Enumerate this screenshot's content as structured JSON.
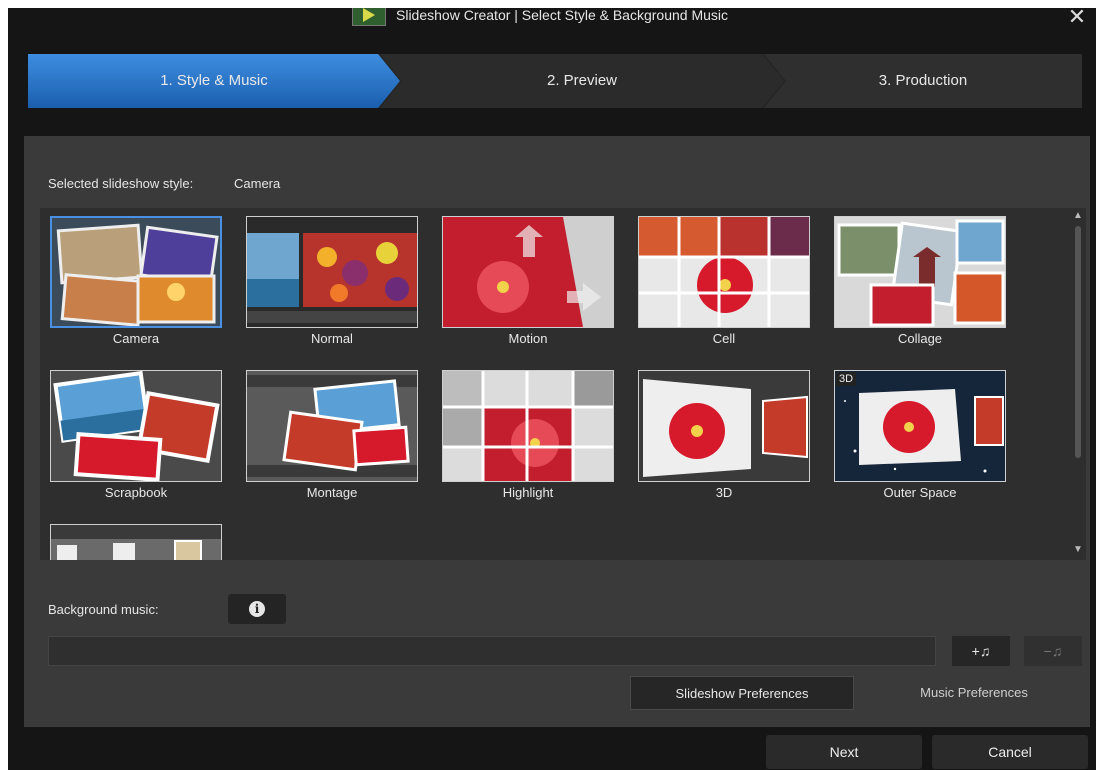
{
  "window": {
    "title": "Slideshow Creator | Select Style & Background Music",
    "close_symbol": "✕"
  },
  "steps": [
    {
      "label": "1. Style & Music",
      "active": true
    },
    {
      "label": "2. Preview",
      "active": false
    },
    {
      "label": "3. Production",
      "active": false
    }
  ],
  "selected_style": {
    "label": "Selected slideshow style:",
    "value": "Camera"
  },
  "styles": [
    {
      "name": "Camera",
      "selected": true
    },
    {
      "name": "Normal"
    },
    {
      "name": "Motion"
    },
    {
      "name": "Cell"
    },
    {
      "name": "Collage"
    },
    {
      "name": "Scrapbook"
    },
    {
      "name": "Montage"
    },
    {
      "name": "Highlight"
    },
    {
      "name": "3D"
    },
    {
      "name": "Outer Space",
      "badge": "3D"
    }
  ],
  "scrollbar": {
    "up": "▲",
    "down": "▼"
  },
  "music": {
    "label": "Background music:",
    "info_symbol": "i",
    "add_label": "+♫",
    "remove_label": "−♫"
  },
  "buttons": {
    "slideshow_preferences": "Slideshow Preferences",
    "music_preferences": "Music Preferences",
    "next": "Next",
    "cancel": "Cancel"
  },
  "colors": {
    "accent": "#2f7ad1",
    "window_bg": "#151515",
    "panel_bg": "#3a3a3a"
  }
}
